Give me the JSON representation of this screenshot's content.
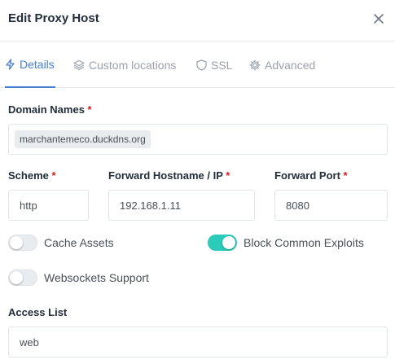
{
  "modal": {
    "title": "Edit Proxy Host"
  },
  "tabs": [
    {
      "label": "Details",
      "icon": "bolt-icon"
    },
    {
      "label": "Custom locations",
      "icon": "layers-icon"
    },
    {
      "label": "SSL",
      "icon": "shield-icon"
    },
    {
      "label": "Advanced",
      "icon": "gear-icon"
    }
  ],
  "form": {
    "domain_names": {
      "label": "Domain Names",
      "required": "*",
      "chips": [
        "marchantemeco.duckdns.org"
      ]
    },
    "scheme": {
      "label": "Scheme",
      "required": "*",
      "value": "http"
    },
    "forward_host": {
      "label": "Forward Hostname / IP",
      "required": "*",
      "value": "192.168.1.11"
    },
    "forward_port": {
      "label": "Forward Port",
      "required": "*",
      "value": "8080"
    },
    "cache_assets": {
      "label": "Cache Assets",
      "enabled": false
    },
    "block_exploits": {
      "label": "Block Common Exploits",
      "enabled": true
    },
    "websockets": {
      "label": "Websockets Support",
      "enabled": false
    },
    "access_list": {
      "label": "Access List",
      "value": "web"
    }
  },
  "colors": {
    "accent": "#467fcf",
    "toggle_on": "#2bcbba",
    "required": "#cd201f"
  }
}
